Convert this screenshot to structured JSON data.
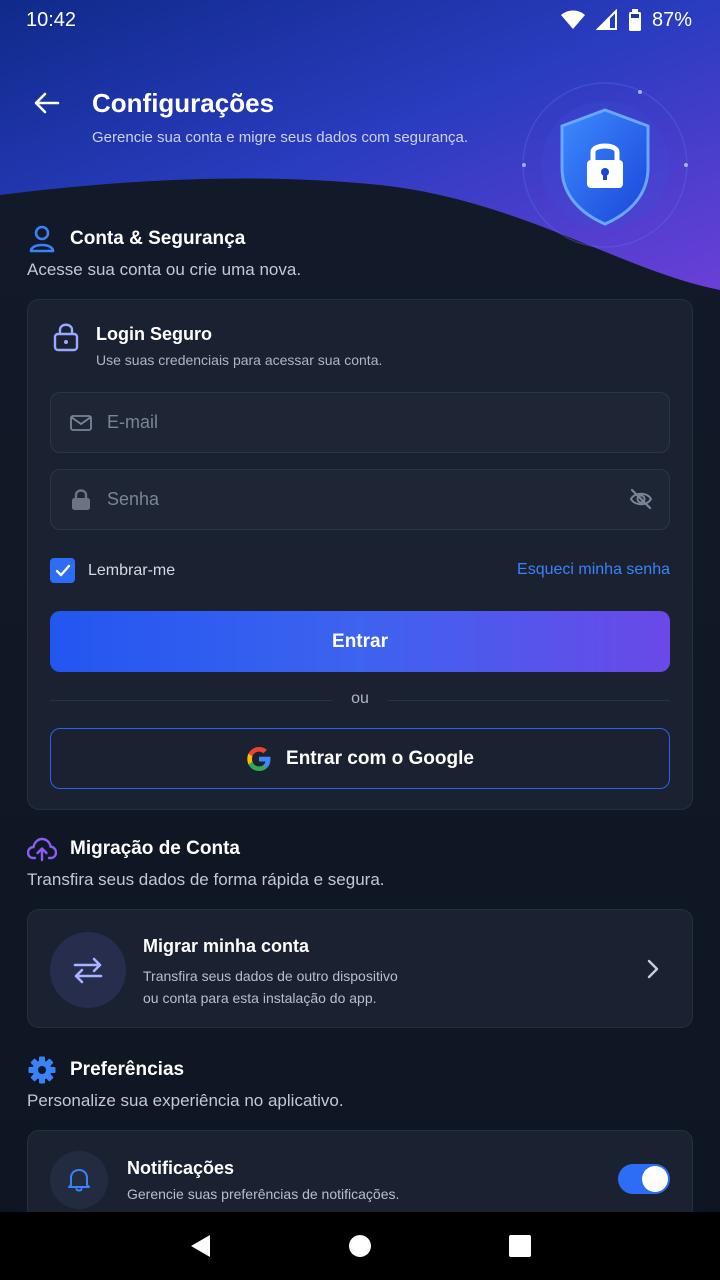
{
  "status": {
    "time": "10:42",
    "battery": "87%"
  },
  "header": {
    "title": "Configurações",
    "subtitle": "Gerencie sua conta e migre seus dados com segurança."
  },
  "account": {
    "title": "Conta & Segurança",
    "description": "Acesse sua conta ou crie uma nova.",
    "login": {
      "title": "Login Seguro",
      "subtitle": "Use suas credenciais para acessar sua conta.",
      "email_placeholder": "E-mail",
      "password_placeholder": "Senha",
      "remember_label": "Lembrar-me",
      "remember_checked": true,
      "forgot_label": "Esqueci minha senha",
      "submit_label": "Entrar",
      "or_label": "ou",
      "google_label": "Entrar com o Google"
    }
  },
  "migration": {
    "title": "Migração de Conta",
    "description": "Transfira seus dados de forma rápida e segura.",
    "item_title": "Migrar minha conta",
    "item_desc_line1": "Transfira seus dados de outro dispositivo",
    "item_desc_line2": "ou conta para esta instalação do app."
  },
  "preferences": {
    "title": "Preferências",
    "description": "Personalize sua experiência no aplicativo.",
    "notifications_title": "Notificações",
    "notifications_desc": "Gerencie suas preferências de notificações.",
    "notifications_enabled": true
  },
  "colors": {
    "accent": "#2d6df6",
    "link": "#3b82f6",
    "purple": "#7c4dff",
    "background": "#111826",
    "card": "#1a2231"
  }
}
